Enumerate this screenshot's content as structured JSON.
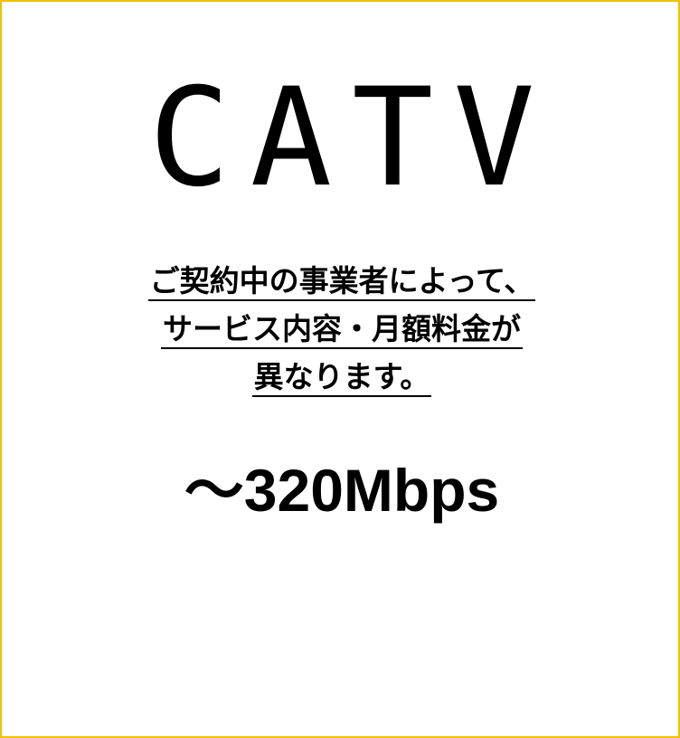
{
  "title": "CATV",
  "note": {
    "line1": "ご契約中の事業者によって、",
    "line2": "サービス内容・月額料金が",
    "line3": "異なります。"
  },
  "speed": "～320Mbps",
  "colors": {
    "border": "#f0c000",
    "text": "#000000",
    "background": "#ffffff"
  }
}
